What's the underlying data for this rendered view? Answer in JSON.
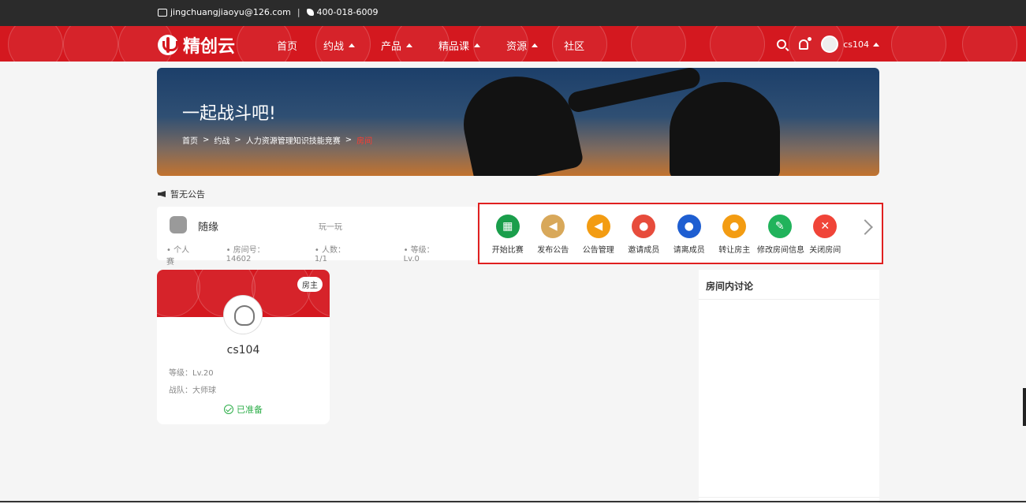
{
  "topbar": {
    "email": "jingchuangjiaoyu@126.com",
    "separator": "|",
    "phone": "400-018-6009"
  },
  "brand": {
    "name": "精创云"
  },
  "nav": {
    "items": [
      {
        "label": "首页",
        "dropdown": false
      },
      {
        "label": "约战",
        "dropdown": true
      },
      {
        "label": "产品",
        "dropdown": true
      },
      {
        "label": "精品课",
        "dropdown": true
      },
      {
        "label": "资源",
        "dropdown": true
      },
      {
        "label": "社区",
        "dropdown": false
      }
    ],
    "username": "cs104"
  },
  "banner": {
    "title": "一起战斗吧!",
    "breadcrumb": [
      "首页",
      "约战",
      "人力资源管理知识技能竞赛",
      "房间"
    ],
    "breadcrumb_sep": ">"
  },
  "notice": {
    "text": "暂无公告"
  },
  "room": {
    "name": "随缘",
    "mode": "玩一玩",
    "type": "个人赛",
    "number": "房间号：14602",
    "players": "人数：1/1",
    "level": "等级：Lv.0"
  },
  "actions": [
    {
      "label": "开始比赛",
      "icon": "checker-icon",
      "color": "#1a9e4b"
    },
    {
      "label": "发布公告",
      "icon": "megaphone-icon",
      "color": "#d8a85a"
    },
    {
      "label": "公告管理",
      "icon": "megaphone-gear-icon",
      "color": "#f39c12"
    },
    {
      "label": "邀请成员",
      "icon": "user-add-icon",
      "color": "#e74c3c"
    },
    {
      "label": "请离成员",
      "icon": "user-remove-icon",
      "color": "#1e5ed1"
    },
    {
      "label": "转让房主",
      "icon": "user-transfer-icon",
      "color": "#f39c12"
    },
    {
      "label": "修改房间信息",
      "icon": "pencil-icon",
      "color": "#21b35b"
    },
    {
      "label": "关闭房间",
      "icon": "close-icon",
      "color": "#f04438"
    }
  ],
  "player": {
    "badge": "房主",
    "name": "cs104",
    "level": "等级：Lv.20",
    "team": "战队：大师球",
    "status": "已准备"
  },
  "discussion": {
    "title": "房间内讨论"
  },
  "colors": {
    "brand_red": "#d4181f",
    "ready_green": "#2dae49",
    "highlight_border": "#e02020"
  }
}
